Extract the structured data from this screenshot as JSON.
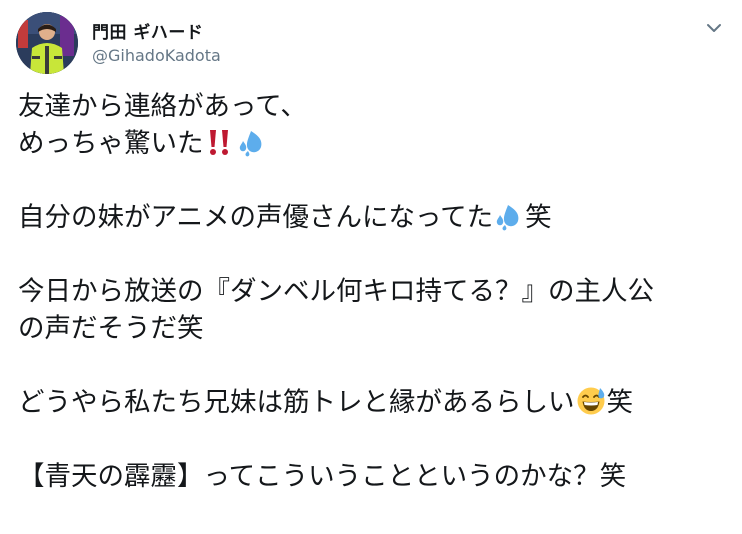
{
  "author": {
    "display_name": "門田 ギハード",
    "handle": "@GihadoKadota",
    "avatar_icon": "profile-photo-athlete"
  },
  "menu": {
    "icon": "chevron-down-icon"
  },
  "tweet": {
    "line1": "友達から連絡があって、",
    "line2": "めっちゃ驚いた",
    "line2_emojis": [
      "double-exclamation-icon",
      "sweat-droplets-icon"
    ],
    "line3_text": "自分の妹がアニメの声優さんになってた",
    "line3_suffix": "笑",
    "line3_emoji": "sweat-droplets-icon",
    "line4": "今日から放送の『ダンベル何キロ持てる？』の主人公",
    "line5": "の声だそうだ笑",
    "line6_text": "どうやら私たち兄妹は筋トレと縁があるらしい",
    "line6_suffix": "笑",
    "line6_emoji": "grinning-sweat-face-icon",
    "line7": "【青天の霹靂】ってこういうことというのかな？笑"
  },
  "colors": {
    "text": "#14171a",
    "secondary": "#657786",
    "exclamation_red": "#be1931",
    "droplet_blue": "#5dadec"
  }
}
